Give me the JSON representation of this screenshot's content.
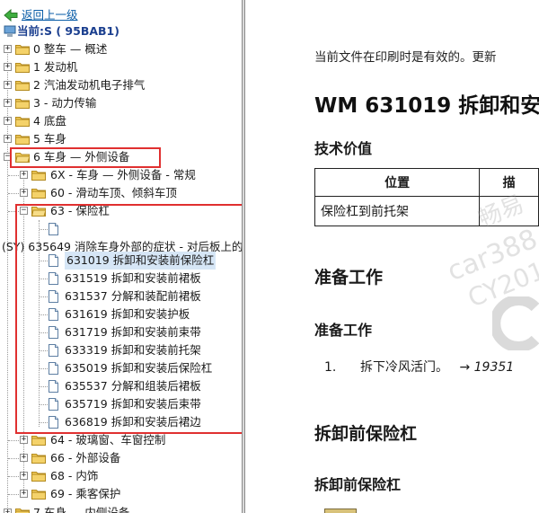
{
  "tree": {
    "back_label": "返回上一级",
    "current_label": "当前:S ( 95BAB1)",
    "items": [
      {
        "label": "0 整车 — 概述",
        "state": "collapsed"
      },
      {
        "label": "1 发动机",
        "state": "collapsed"
      },
      {
        "label": "2 汽油发动机电子排气",
        "state": "collapsed"
      },
      {
        "label": "3 - 动力传输",
        "state": "collapsed"
      },
      {
        "label": "4 底盘",
        "state": "collapsed"
      },
      {
        "label": "5 车身",
        "state": "collapsed"
      },
      {
        "label": "6 车身 — 外侧设备",
        "state": "expanded"
      }
    ],
    "sub_items": [
      {
        "label": "6X - 车身 — 外侧设备 - 常规",
        "state": "collapsed"
      },
      {
        "label": "60 - 滑动车顶、倾斜车顶",
        "state": "collapsed"
      },
      {
        "label": "63 - 保险杠",
        "state": "expanded"
      }
    ],
    "blank_doc_label": "",
    "symptom_label": "(SY) 635649 消除车身外部的症状 - 对后板上的",
    "docs": [
      "631019 拆卸和安装前保险杠",
      "631519 拆卸和安装前裙板",
      "631537 分解和装配前裙板",
      "631619 拆卸和安装护板",
      "631719 拆卸和安装前束带",
      "633319 拆卸和安装前托架",
      "635019 拆卸和安装后保险杠",
      "635537 分解和组装后裙板",
      "635719 拆卸和安装后束带",
      "636819 拆卸和安装后裙边"
    ],
    "selected_doc_index": 0,
    "more_sub_items": [
      {
        "label": "64 - 玻璃窗、车窗控制",
        "state": "collapsed"
      },
      {
        "label": "66 - 外部设备",
        "state": "collapsed"
      },
      {
        "label": "68 - 内饰",
        "state": "collapsed"
      },
      {
        "label": "69 - 乘客保护",
        "state": "collapsed"
      }
    ],
    "last_item": {
      "label": "7 车身 — 内侧设备",
      "state": "collapsed"
    }
  },
  "document": {
    "intro": "当前文件在印刷时是有效的。更新",
    "title": "WM 631019 拆卸和安",
    "tech_heading": "技术价值",
    "table": {
      "headers": [
        "位置",
        "描"
      ],
      "rows": [
        [
          "保险杠到前托架",
          ""
        ]
      ]
    },
    "prep_heading": "准备工作",
    "prep_subheading": "准备工作",
    "steps": [
      {
        "num": "1.",
        "text": "拆下冷风活门。",
        "ref": "→ 19351"
      }
    ],
    "remove_heading": "拆卸前保险杠",
    "remove_subheading": "拆卸前保险杠"
  },
  "watermark": {
    "line1": "畅易",
    "line2": "car388.c",
    "line3": "CY201"
  },
  "colors": {
    "highlight_box": "#e03030",
    "link": "#0b5ea8",
    "selection": "#d6e6f6",
    "folder": "#f2cc5c"
  }
}
